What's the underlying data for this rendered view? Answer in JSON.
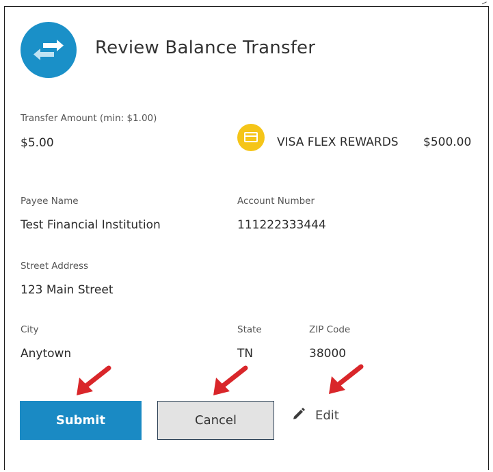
{
  "header": {
    "title": "Review Balance Transfer",
    "icon": "transfer-arrows-icon",
    "icon_color": "#1a90c8"
  },
  "transfer": {
    "amount_label": "Transfer Amount (min: $1.00)",
    "amount_value": "$5.00",
    "card_icon": "credit-card-icon",
    "card_icon_color": "#f5c518",
    "card_name": "VISA FLEX REWARDS",
    "card_balance": "$500.00"
  },
  "payee": {
    "name_label": "Payee Name",
    "name_value": "Test Financial Institution",
    "account_label": "Account Number",
    "account_value": "111222333444",
    "street_label": "Street Address",
    "street_value": "123 Main Street",
    "city_label": "City",
    "city_value": "Anytown",
    "state_label": "State",
    "state_value": "TN",
    "zip_label": "ZIP Code",
    "zip_value": "38000"
  },
  "actions": {
    "submit_label": "Submit",
    "cancel_label": "Cancel",
    "edit_label": "Edit",
    "edit_icon": "pencil-icon",
    "submit_color": "#1a8ac4",
    "annotation_arrow_color": "#d9262a"
  }
}
